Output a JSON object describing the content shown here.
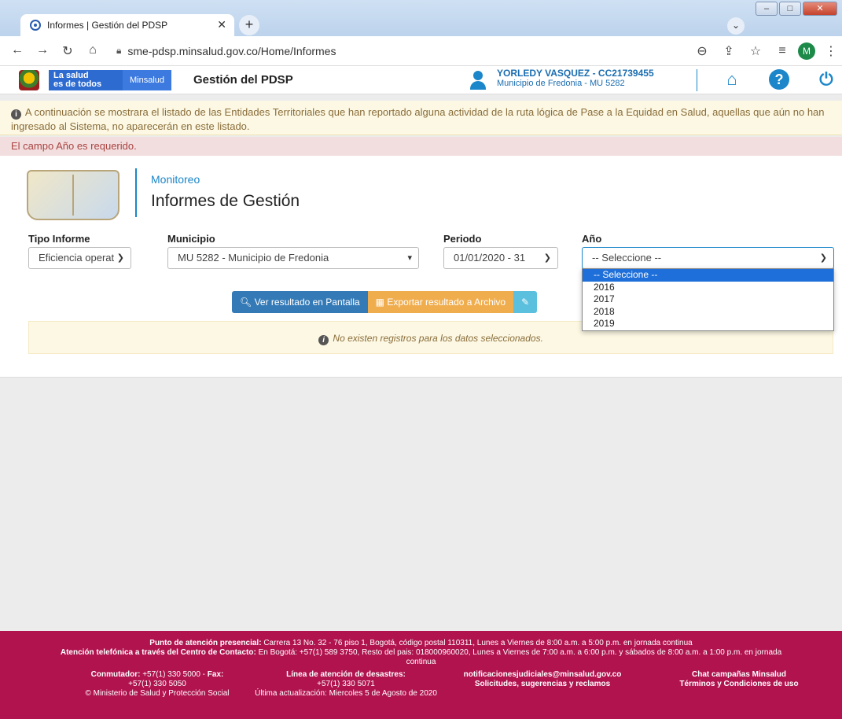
{
  "browser": {
    "tab_title": "Informes | Gestión del PDSP",
    "url": "sme-pdsp.minsalud.gov.co/Home/Informes",
    "profile_initial": "M"
  },
  "header": {
    "logo_line1": "La salud",
    "logo_line2": "es de todos",
    "minsalud": "Minsalud",
    "site_title": "Gestión del PDSP",
    "user_name": "YORLEDY VASQUEZ - CC21739455",
    "user_municipio": "Municipio de Fredonia - MU 5282"
  },
  "alerts": {
    "info": "A continuación se mostrara el listado de las Entidades Territoriales que han reportado alguna actividad de la ruta lógica de Pase a la Equidad en Salud, aquellas que aún no han ingresado al Sistema, no aparecerán en este listado.",
    "error": "El campo Año es requerido."
  },
  "page": {
    "breadcrumb": "Monitoreo",
    "title": "Informes de Gestión"
  },
  "filters": {
    "tipo_label": "Tipo Informe",
    "tipo_value": "Eficiencia operat",
    "municipio_label": "Municipio",
    "municipio_value": "MU 5282 - Municipio de Fredonia",
    "periodo_label": "Periodo",
    "periodo_value": "01/01/2020 - 31",
    "anio_label": "Año",
    "anio_value": "-- Seleccione --",
    "anio_options": [
      "-- Seleccione --",
      "2016",
      "2017",
      "2018",
      "2019"
    ]
  },
  "actions": {
    "ver": "Ver resultado en Pantalla",
    "exportar": "Exportar resultado a Archivo"
  },
  "results": {
    "empty": "No existen registros para los datos seleccionados."
  },
  "footer": {
    "line1_b": "Punto de atención presencial:",
    "line1": "Carrera 13 No. 32 - 76 piso 1, Bogotá, código postal 110311, Lunes a Viernes de 8:00 a.m. a 5:00 p.m. en jornada continua",
    "line2_b": "Atención telefónica a través del Centro de Contacto:",
    "line2": "En Bogotá: +57(1) 589 3750, Resto del pais: 018000960020, Lunes a Viernes de 7:00 a.m. a 6:00 p.m. y sábados de 8:00 a.m. a 1:00 p.m. en jornada continua",
    "conmutador_b": "Conmutador:",
    "conmutador": "+57(1) 330 5000 -",
    "fax_b": "Fax:",
    "fax": "+57(1) 330 5050",
    "copyright": "© Ministerio de Salud y Protección Social",
    "desastres_b": "Línea de atención de desastres:",
    "desastres": "+57(1) 330 5071",
    "actualizacion": "Última actualización: Miercoles 5 de Agosto de 2020",
    "email": "notificacionesjudiciales@minsalud.gov.co",
    "solicitudes": "Solicitudes, sugerencias y reclamos",
    "chat": "Chat campañas Minsalud",
    "terminos": "Términos y Condiciones de uso"
  }
}
